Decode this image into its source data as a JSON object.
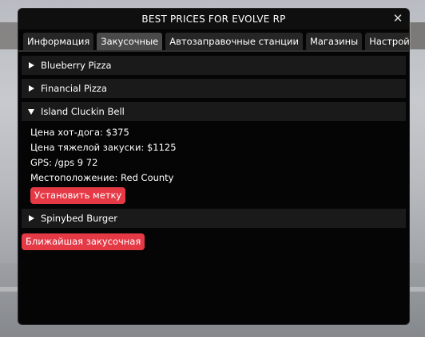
{
  "window": {
    "title": "BEST PRICES FOR EVOLVE RP",
    "close_glyph": "✕"
  },
  "tabs": [
    {
      "label": "Информация",
      "active": false
    },
    {
      "label": "Закусочные",
      "active": true
    },
    {
      "label": "Автозаправочные станции",
      "active": false
    },
    {
      "label": "Магазины",
      "active": false
    },
    {
      "label": "Настройки",
      "active": false
    }
  ],
  "restaurants": [
    {
      "name": "Blueberry Pizza",
      "expanded": false
    },
    {
      "name": "Financial Pizza",
      "expanded": false
    },
    {
      "name": "Island Cluckin Bell",
      "expanded": true,
      "details": {
        "hotdog": "Цена хот-дога: $375",
        "heavy_snack": "Цена тяжелой закуски: $1125",
        "gps": "GPS: /gps 9 72",
        "location": "Местоположение: Red County"
      },
      "set_marker_label": "Установить метку"
    },
    {
      "name": "Spinybed Burger",
      "expanded": false
    }
  ],
  "nearest_button_label": "Ближайшая закусочная",
  "colors": {
    "accent_red": "#e53946",
    "window_bg": "#050505",
    "header_bg": "#1a1a1a",
    "tab_bg": "#262626",
    "tab_active_bg": "#4a4a4a"
  },
  "icons": {
    "collapsed": "triangle-right-icon",
    "expanded": "triangle-down-icon",
    "close": "close-icon"
  }
}
